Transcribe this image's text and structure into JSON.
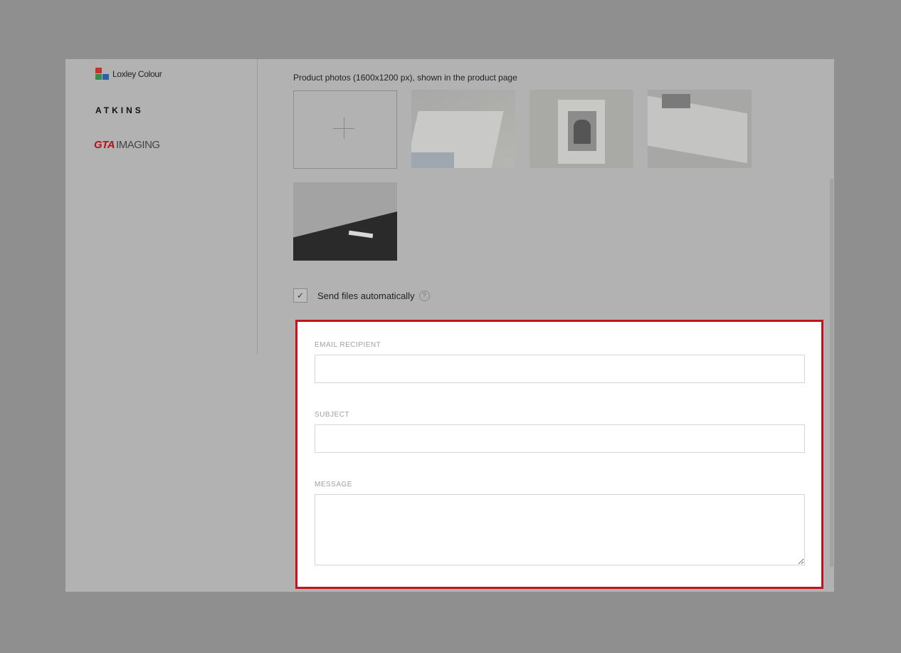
{
  "sidebar": {
    "logos": [
      {
        "name": "loxley-colour-logo",
        "text": "Loxley Colour"
      },
      {
        "name": "atkins-logo",
        "text": "ATKINS"
      },
      {
        "name": "gta-imaging-logo",
        "text_a": "GTA",
        "text_b": "IMAGING"
      }
    ]
  },
  "main": {
    "photos_label": "Product photos (1600x1200 px), shown in the product page",
    "add_photo_icon": "plus-icon",
    "photos_count": 5,
    "send_files": {
      "label": "Send files automatically",
      "checked": true,
      "help_icon": "question-icon",
      "check_icon": "checkmark-icon"
    }
  },
  "email_form": {
    "email_recipient_label": "EMAIL RECIPIENT",
    "email_recipient_value": "",
    "subject_label": "SUBJECT",
    "subject_value": "",
    "message_label": "MESSAGE",
    "message_value": ""
  },
  "colors": {
    "overlay": "#8f8f8f",
    "modal_bg": "#b2b2b2",
    "highlight_border": "#c0151c",
    "gta_red": "#b5121b"
  }
}
